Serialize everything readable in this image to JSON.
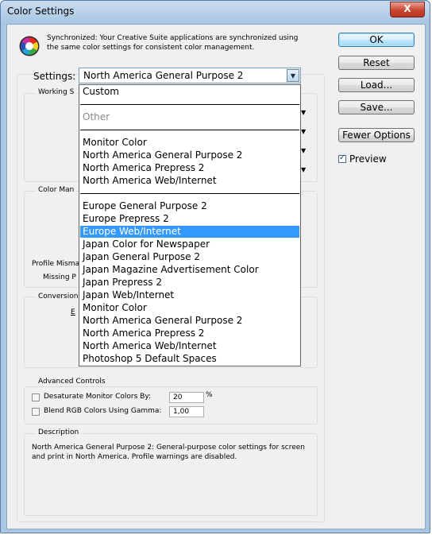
{
  "window": {
    "title": "Color Settings",
    "close_glyph": "X"
  },
  "sync": {
    "icon": "color-wheel-icon",
    "text": "Synchronized: Your Creative Suite applications are synchronized using the same color settings for consistent color management."
  },
  "buttons": {
    "ok": "OK",
    "reset": "Reset",
    "load": "Load...",
    "save": "Save...",
    "fewer": "Fewer Options"
  },
  "preview": {
    "label": "Preview",
    "checked": true
  },
  "settings": {
    "label": "Settings:",
    "value": "North America General Purpose 2",
    "dropdown": {
      "items": [
        {
          "label": "Custom"
        },
        {
          "separator": true
        },
        {
          "label": "Other",
          "disabled": true
        },
        {
          "separator": true
        },
        {
          "label": "Monitor Color"
        },
        {
          "label": "North America General Purpose 2"
        },
        {
          "label": "North America Prepress 2"
        },
        {
          "label": "North America Web/Internet"
        },
        {
          "separator": true
        },
        {
          "label": "Europe General Purpose 2"
        },
        {
          "label": "Europe Prepress 2"
        },
        {
          "label": "Europe Web/Internet",
          "selected": true
        },
        {
          "label": "Japan Color for Newspaper"
        },
        {
          "label": "Japan General Purpose 2"
        },
        {
          "label": "Japan Magazine Advertisement Color"
        },
        {
          "label": "Japan Prepress 2"
        },
        {
          "label": "Japan Web/Internet"
        },
        {
          "label": "Monitor Color"
        },
        {
          "label": "North America General Purpose 2"
        },
        {
          "label": "North America Prepress 2"
        },
        {
          "label": "North America Web/Internet"
        },
        {
          "label": "Photoshop 5 Default Spaces"
        }
      ]
    }
  },
  "groups": {
    "working_spaces": "Working S",
    "color_management": "Color Man",
    "profile_mismatches": "Profile Misma",
    "missing_profiles": "Missing P",
    "conversion": "Conversion",
    "conversion_engine_fragment": "E",
    "advanced": "Advanced Controls",
    "description": "Description"
  },
  "advanced": {
    "desaturate_label": "Desaturate Monitor Colors By:",
    "desaturate_value": "20",
    "desaturate_unit": "%",
    "blend_label": "Blend RGB Colors Using Gamma:",
    "blend_value": "1,00"
  },
  "description": {
    "text": "North America General Purpose 2:  General-purpose color settings for screen and print in North America. Profile warnings are disabled."
  }
}
